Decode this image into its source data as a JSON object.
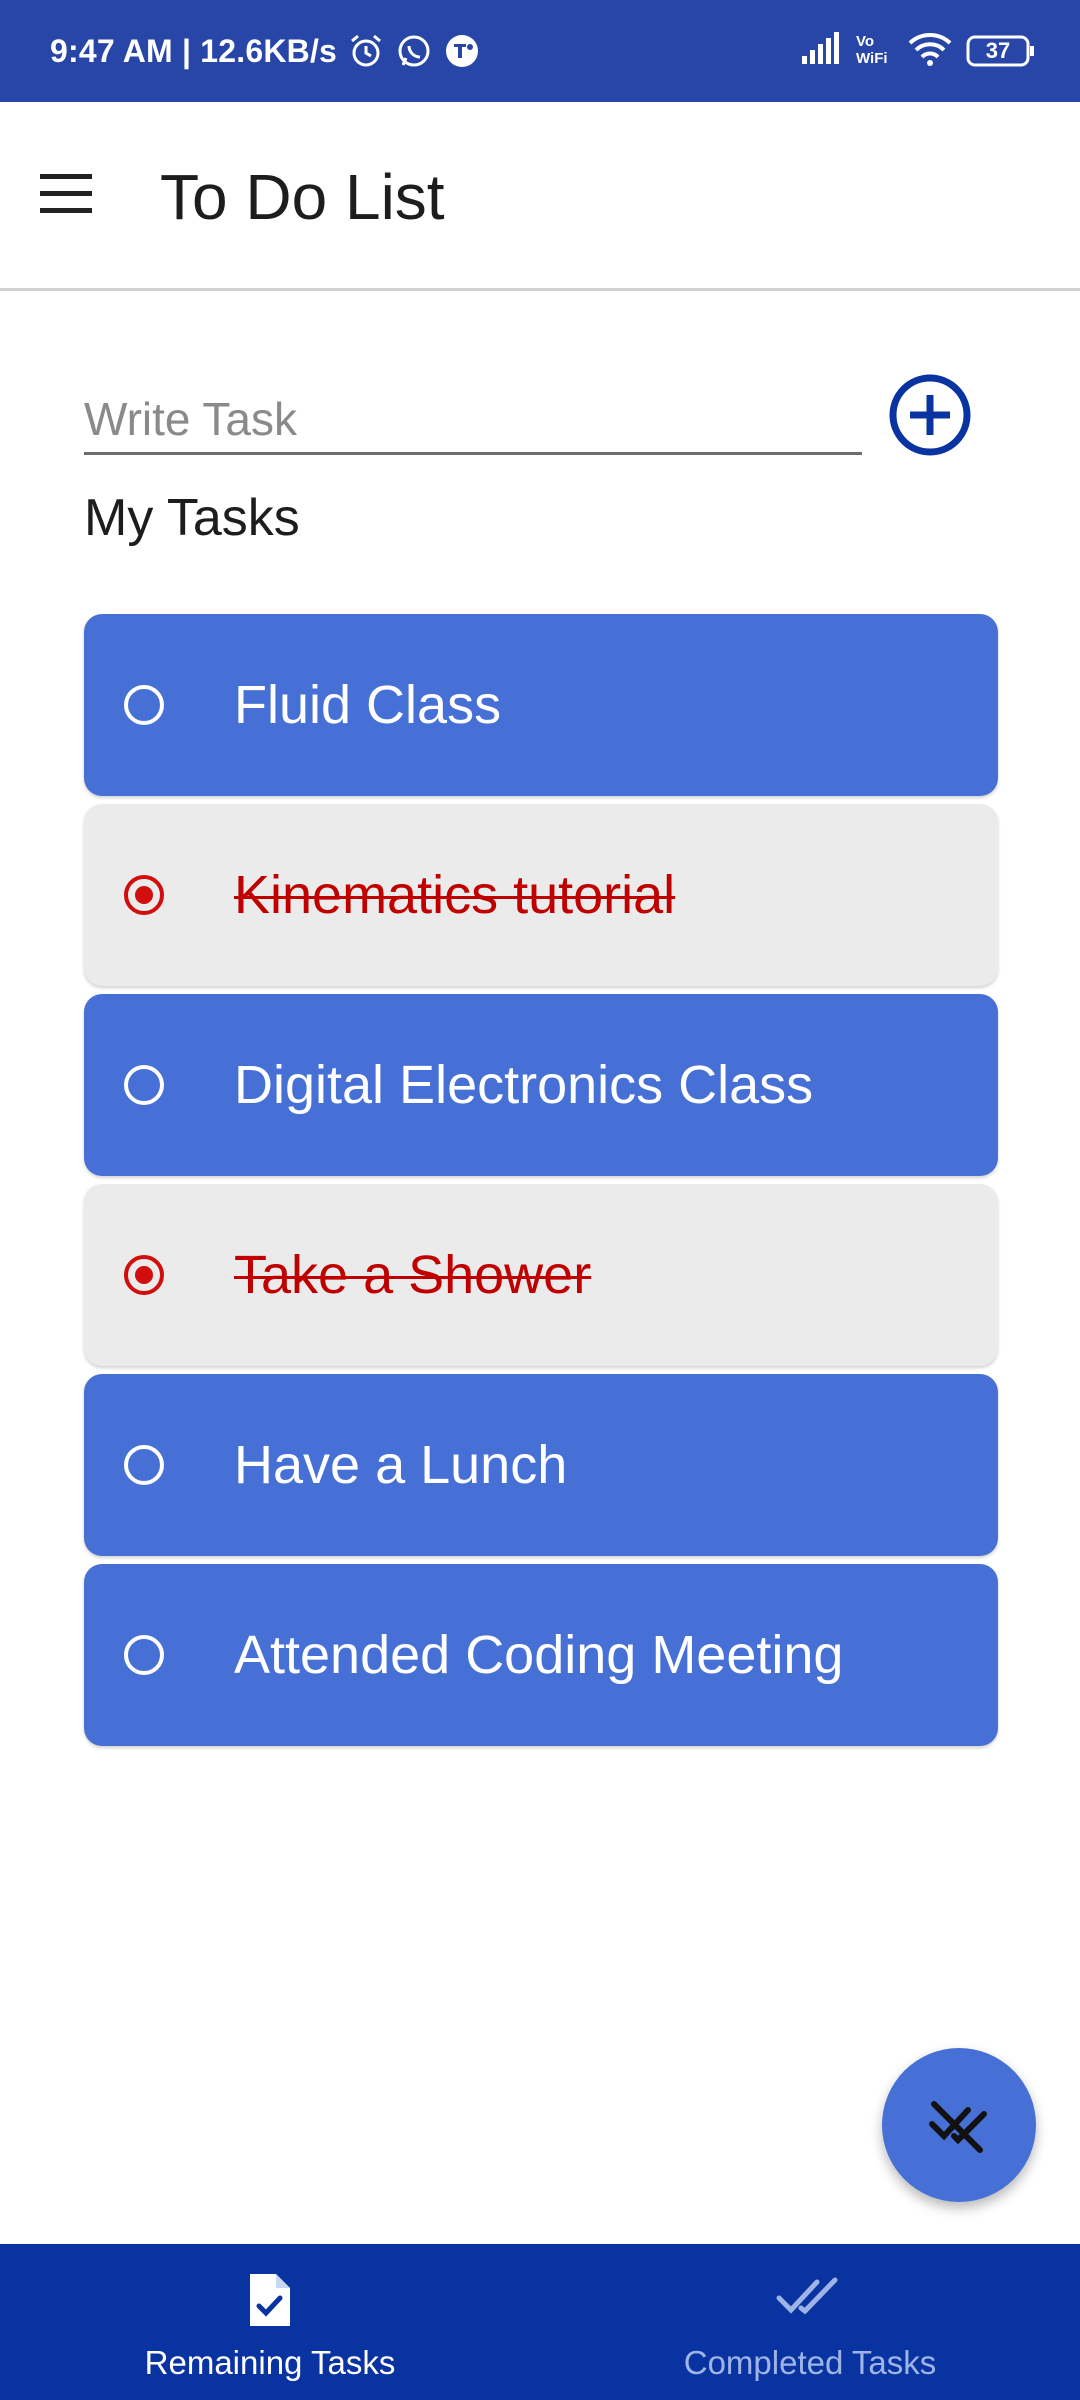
{
  "status_bar": {
    "time_info": "9:47 AM | 12.6KB/s",
    "battery": "37",
    "icons": [
      "alarm-icon",
      "whatsapp-icon",
      "teams-icon",
      "signal-icon",
      "vowifi-icon",
      "wifi-icon",
      "battery-icon"
    ]
  },
  "app_bar": {
    "title": "To Do List",
    "menu_icon": "hamburger-menu-icon"
  },
  "task_input": {
    "placeholder": "Write Task",
    "value": ""
  },
  "add_button": {
    "icon": "plus-circle-icon",
    "color": "#0a33a2"
  },
  "section_title": "My Tasks",
  "tasks": [
    {
      "label": "Fluid Class",
      "completed": false
    },
    {
      "label": "Kinematics tutorial",
      "completed": true
    },
    {
      "label": "Digital Electronics Class",
      "completed": false
    },
    {
      "label": "Take a Shower",
      "completed": true
    },
    {
      "label": "Have a Lunch",
      "completed": false
    },
    {
      "label": "Attended Coding Meeting",
      "completed": false
    }
  ],
  "fab": {
    "icon": "clear-all-done-icon"
  },
  "bottom_nav": {
    "tabs": [
      {
        "label": "Remaining Tasks",
        "icon": "task-document-icon",
        "active": true
      },
      {
        "label": "Completed Tasks",
        "icon": "double-check-icon",
        "active": false
      }
    ]
  },
  "colors": {
    "status_bar": "#2746a7",
    "task_pending": "#4670d5",
    "task_done": "#ebebeb",
    "done_text": "#c00000",
    "bottom_nav": "#0a33a2"
  }
}
